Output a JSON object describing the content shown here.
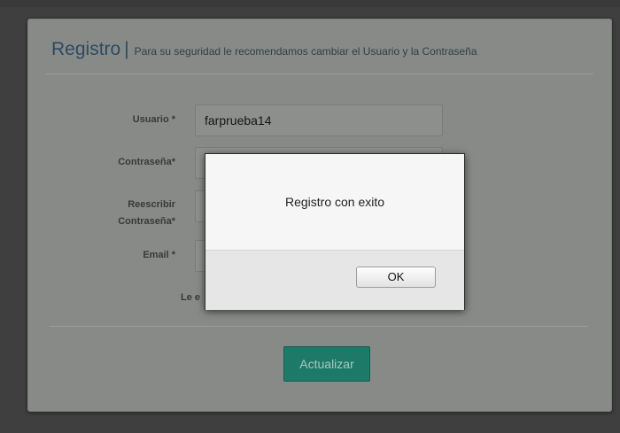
{
  "form": {
    "title": "Registro",
    "title_separator": "|",
    "subtitle": "Para su seguridad le recomendamos cambiar el Usuario y la Contraseña",
    "fields": {
      "usuario": {
        "label": "Usuario *",
        "value": "farprueba14"
      },
      "contrasena": {
        "label": "Contraseña*",
        "value": ""
      },
      "reescribir": {
        "label_line1": "Reescribir",
        "label_line2": "Contraseña*",
        "value": ""
      },
      "email": {
        "label": "Email *",
        "value": ""
      }
    },
    "hint_text": "Le e",
    "submit_label": "Actualizar"
  },
  "dialog": {
    "message": "Registro con exito",
    "ok_label": "OK"
  },
  "colors": {
    "accent_button": "#1e7a68",
    "title_color": "#2c4a60"
  }
}
